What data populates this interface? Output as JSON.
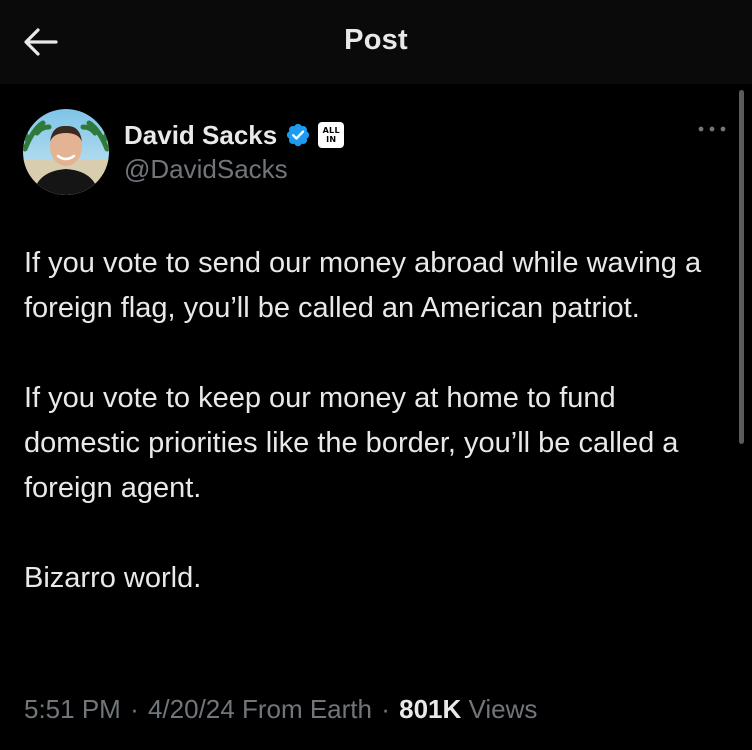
{
  "header": {
    "title": "Post",
    "back_icon": "arrow-left-icon"
  },
  "author": {
    "display_name": "David Sacks",
    "handle": "@DavidSacks",
    "verified_icon": "verified-badge-icon",
    "verified_color": "#1d9bf0",
    "affiliation_badge": {
      "line1": "ALL",
      "line2": "IN"
    }
  },
  "post": {
    "paragraphs": [
      "If you vote to send our money abroad while waving a foreign flag, you’ll be called an American patriot.",
      "If you vote to keep our money at home to fund domestic priorities like the border, you’ll be called a foreign agent.",
      "Bizarro world."
    ],
    "time": "5:51 PM",
    "separator": "·",
    "date": "4/20/24",
    "source": "From Earth",
    "views_count": "801K",
    "views_label": "Views"
  },
  "colors": {
    "background": "#000000",
    "header_background": "#0a0a0a",
    "primary_text": "#e7e9ea",
    "secondary_text": "#71767b",
    "accent": "#1d9bf0"
  }
}
